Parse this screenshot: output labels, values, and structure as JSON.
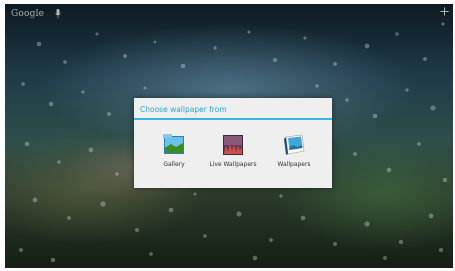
{
  "search_bar": {
    "label": "Google",
    "mic_icon": "microphone-icon"
  },
  "top_right": {
    "icon": "add-icon"
  },
  "dialog": {
    "title": "Choose wallpaper from",
    "accent_color": "#33b5e5",
    "options": [
      {
        "label": "Gallery",
        "icon": "gallery-icon"
      },
      {
        "label": "Live Wallpapers",
        "icon": "live-wallpapers-icon"
      },
      {
        "label": "Wallpapers",
        "icon": "wallpapers-icon"
      }
    ]
  }
}
